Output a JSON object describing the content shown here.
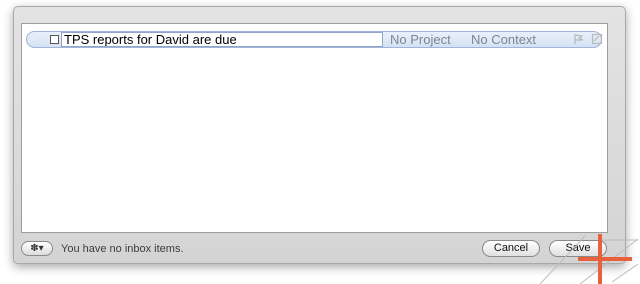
{
  "task": {
    "title": "TPS reports for David are due",
    "project": "No Project",
    "context": "No Context",
    "icons": [
      "flag-icon",
      "note-icon",
      "checkbox"
    ]
  },
  "footer": {
    "gear_label": "✽▾",
    "status_text": "You have no inbox items.",
    "cancel_label": "Cancel",
    "save_label": "Save"
  },
  "colors": {
    "row_fill": "#d5e2f4",
    "muted_text": "#7d8791",
    "overlay_orange": "#e8603c"
  }
}
